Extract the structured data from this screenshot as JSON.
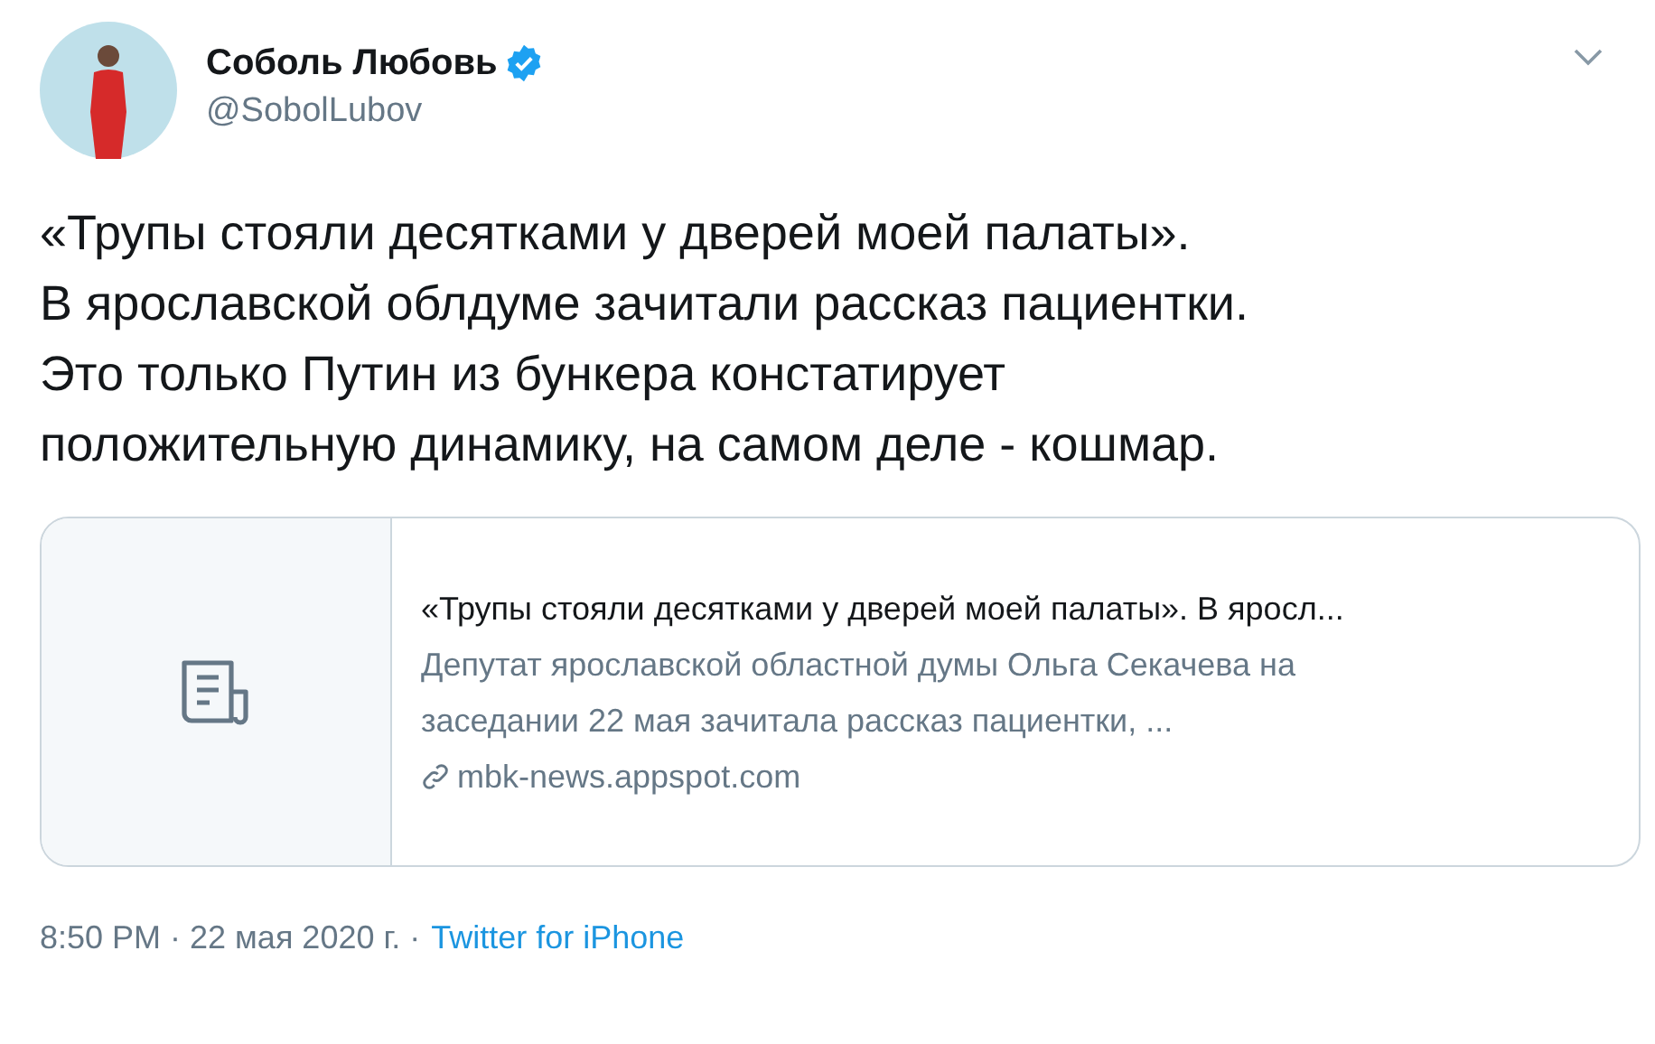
{
  "author": {
    "name": "Соболь Любовь",
    "verified": true,
    "handle": "@SobolLubov"
  },
  "tweet_lines": [
    "«Трупы стояли десятками у дверей моей палаты».",
    "В ярославской облдуме зачитали рассказ пациентки.",
    "Это только Путин из бункера констатирует",
    "положительную динамику, на самом деле - кошмар."
  ],
  "card": {
    "title": "«Трупы стояли десятками у дверей моей палаты». В яросл...",
    "description_lines": [
      "Депутат ярославской областной думы Ольга Секачева на",
      "заседании 22 мая зачитала рассказ пациентки, ..."
    ],
    "domain": "mbk-news.appspot.com"
  },
  "meta": {
    "timestamp": "8:50 PM · 22 мая 2020 г. ·",
    "source": "Twitter for iPhone"
  }
}
